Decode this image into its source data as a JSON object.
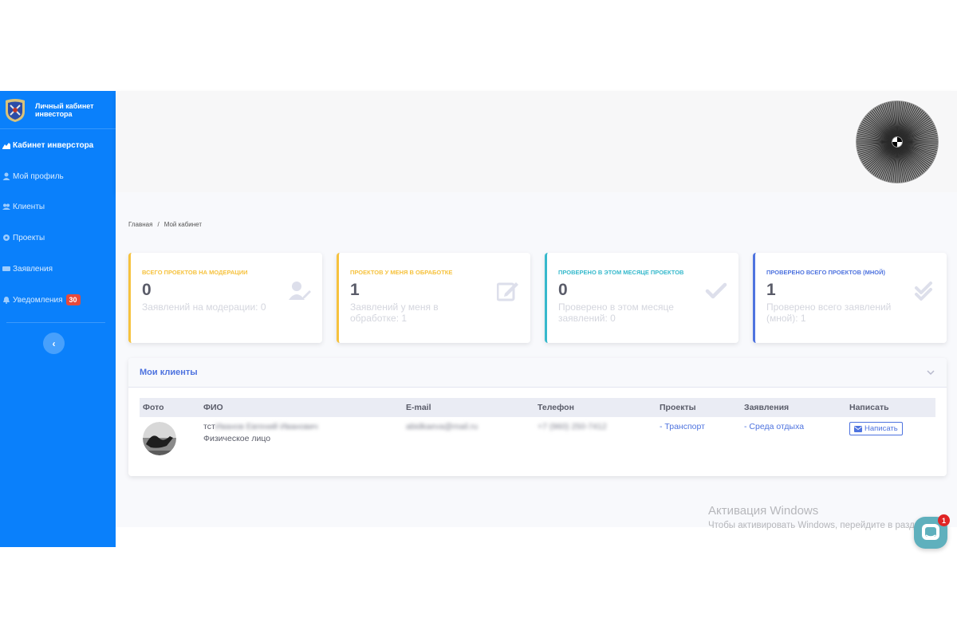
{
  "brand": {
    "name": "Личный кабинет инвестора"
  },
  "nav": {
    "cabinet": "Кабинет инверстора",
    "profile": "Мой профиль",
    "clients": "Клиенты",
    "projects": "Проекты",
    "applications": "Заявления",
    "notifications": "Уведомления",
    "notifications_count": "30",
    "collapse_label": "‹"
  },
  "breadcrumb": {
    "home": "Главная",
    "separator": "/",
    "current": "Мой кабинет"
  },
  "cards": [
    {
      "label": "Всего проектов на модерации",
      "value": "0",
      "sub": "Заявлений на модерации: 0",
      "color": "#f6c23e",
      "icon": "user-edit-icon"
    },
    {
      "label": "Проектов у меня в обработке",
      "value": "1",
      "sub": "Заявлений у меня в обработке: 1",
      "color": "#f6c23e",
      "icon": "edit-icon"
    },
    {
      "label": "Проверено в этом месяце проектов",
      "value": "0",
      "sub": "Проверено в этом месяце заявлений: 0",
      "color": "#36b9cc",
      "icon": "check-icon"
    },
    {
      "label": "Проверено всего проектов (мной)",
      "value": "1",
      "sub": "Проверено всего заявлений (мной): 1",
      "color": "#4e73df",
      "icon": "double-check-icon"
    }
  ],
  "clients_panel": {
    "title": "Мои клиенты",
    "columns": [
      "Фото",
      "ФИО",
      "E-mail",
      "Телефон",
      "Проекты",
      "Заявления",
      "Написать"
    ],
    "rows": [
      {
        "name_prefix": "тст",
        "name_blurred": "Иванов Евгений Иванович",
        "type": "Физическое лицо",
        "email": "abidkaeva@mail.ru",
        "phone": "+7 (960) 250-7412",
        "project": "- Транспорт",
        "application": "- Среда отдыха",
        "write_label": "Написать"
      }
    ]
  },
  "watermark": {
    "title": "Активация Windows",
    "text": "Чтобы активировать Windows, перейдите в разд \"Параметры\"."
  },
  "chat": {
    "badge": "1"
  }
}
